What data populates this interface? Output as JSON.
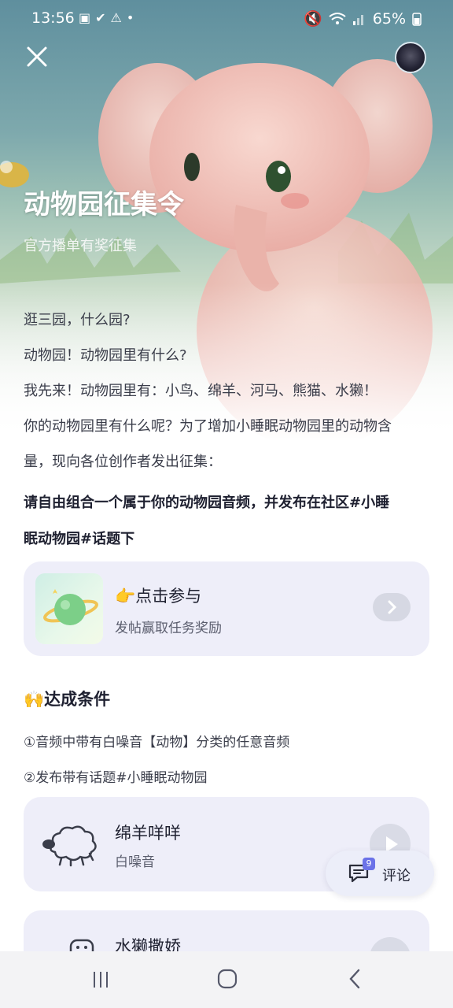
{
  "status_bar": {
    "time": "13:56",
    "left_icons": [
      "image-icon",
      "check-icon",
      "warning-icon",
      "dot-icon"
    ],
    "right_icons": [
      "mute-icon",
      "wifi-icon",
      "signal-icon"
    ],
    "battery": "65%"
  },
  "header": {
    "title": "动物园征集令",
    "subtitle": "官方播单有奖征集"
  },
  "body": {
    "paragraphs": [
      "逛三园，什么园?",
      "动物园！动物园里有什么?",
      "我先来！动物园里有：小鸟、绵羊、河马、熊猫、水獭！",
      "你的动物园里有什么呢？为了增加小睡眠动物园里的动物含",
      "量，现向各位创作者发出征集："
    ],
    "bold_line_1": "请自由组合一个属于你的动物园音频，并发布在社区#小睡",
    "bold_line_2": "眠动物园#话题下"
  },
  "participate_card": {
    "title": "👉点击参与",
    "subtitle": "发帖赢取任务奖励"
  },
  "conditions": {
    "title": "🙌达成条件",
    "items": [
      "①音频中带有白噪音【动物】分类的任意音频",
      "②发布带有话题#小睡眠动物园"
    ]
  },
  "audio_items": [
    {
      "title": "绵羊咩咩",
      "subtitle": "白噪音",
      "icon": "sheep-icon"
    },
    {
      "title": "水獭撒娇",
      "subtitle": "",
      "icon": "otter-icon"
    }
  ],
  "comment_button": {
    "label": "评论",
    "count": "9"
  },
  "colors": {
    "accent": "#6b72e8",
    "card_bg": "#eeeef9",
    "text_primary": "#1e2030"
  }
}
